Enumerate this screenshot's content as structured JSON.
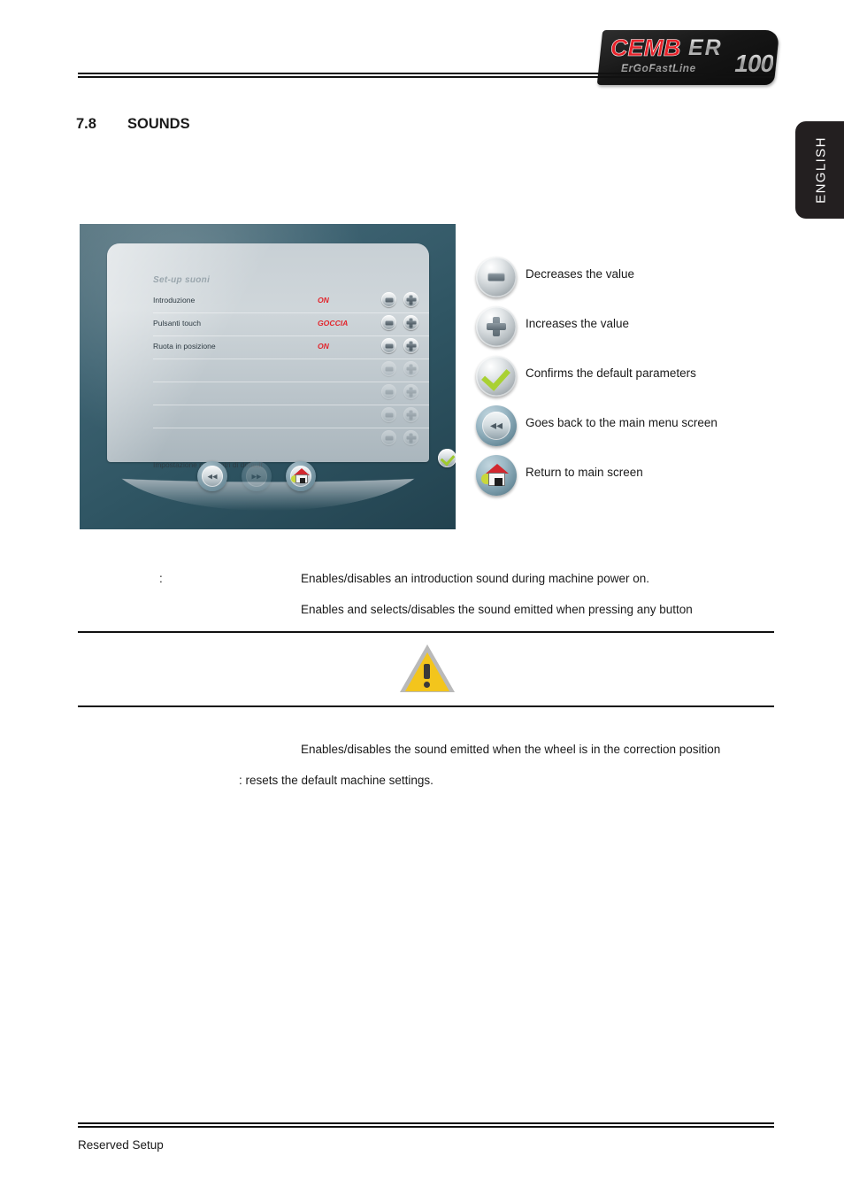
{
  "header": {
    "logo": {
      "brand": "CEMB",
      "model": "ER",
      "number": "100",
      "tagline": "ErGoFastLine"
    }
  },
  "language_tab": {
    "label": "ENGLISH"
  },
  "section": {
    "number": "7.8",
    "title": "SOUNDS"
  },
  "device_screen": {
    "panel_title": "Set-up suoni",
    "rows": [
      {
        "label": "Introduzione",
        "value": "ON"
      },
      {
        "label": "Pulsanti touch",
        "value": "GOCCIA"
      },
      {
        "label": "Ruota in posizione",
        "value": "ON"
      }
    ],
    "default_label": "Impostazione parametri di default",
    "nav": {
      "back": "back-button",
      "forward": "forward-button",
      "home": "home-button"
    }
  },
  "legend": {
    "items": [
      {
        "icon": "minus-button-icon",
        "text": "Decreases the value"
      },
      {
        "icon": "plus-button-icon",
        "text": "Increases the value"
      },
      {
        "icon": "check-button-icon",
        "text": "Confirms the default parameters"
      },
      {
        "icon": "back-button-icon",
        "text": "Goes back to the main menu screen"
      },
      {
        "icon": "home-button-icon",
        "text": "Return to main screen"
      }
    ]
  },
  "body": {
    "colon": ":",
    "para1": "Enables/disables an introduction sound during machine power on.",
    "para2": "Enables and selects/disables the sound emitted when pressing any button",
    "para3": "Enables/disables the sound emitted when the wheel is in the correction position",
    "para4": ": resets the default machine settings."
  },
  "footer": {
    "text": "Reserved Setup"
  },
  "colors": {
    "value_red": "#e2252c",
    "warning_yellow": "#f3c51c",
    "check_green": "#a9d133",
    "tab_black": "#231f20",
    "screen_teal": "#3d6271"
  }
}
